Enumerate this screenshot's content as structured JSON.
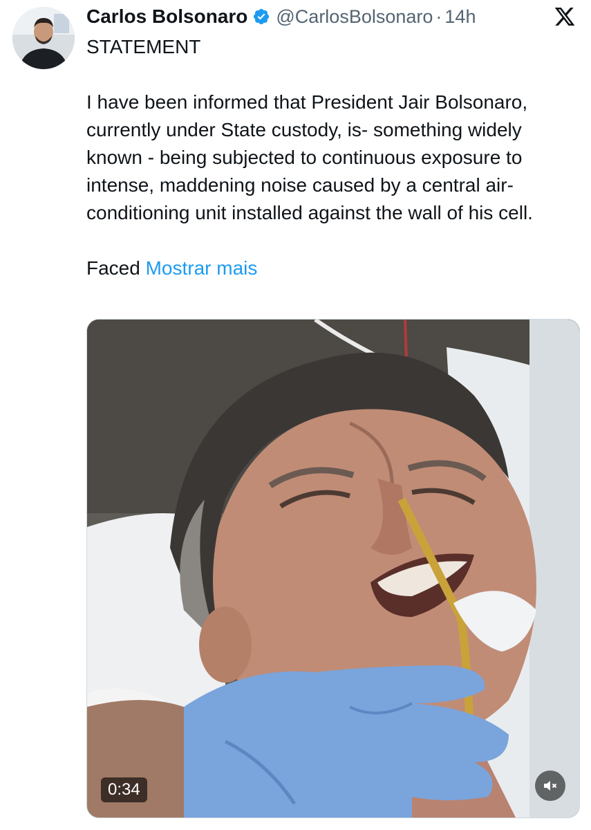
{
  "tweet": {
    "display_name": "Carlos Bolsonaro",
    "verified_icon": "verified-badge-icon",
    "handle": "@CarlosBolsonaro",
    "separator": "·",
    "time": "14h",
    "platform_icon": "x-logo-icon",
    "text": {
      "heading": "STATEMENT",
      "paragraph": "I have been informed that President Jair Bolsonaro, currently under State custody, is- something widely known - being subjected to continuous exposure to intense, maddening noise caused by a central air-conditioning unit installed against the wall of his cell.",
      "truncated_start": "Faced",
      "show_more_label": "Mostrar mais"
    },
    "media": {
      "duration": "0:34",
      "mute_icon": "speaker-muted-icon"
    },
    "colors": {
      "accent": "#1d9bf0",
      "text": "#0f1419",
      "secondary": "#536471"
    }
  }
}
